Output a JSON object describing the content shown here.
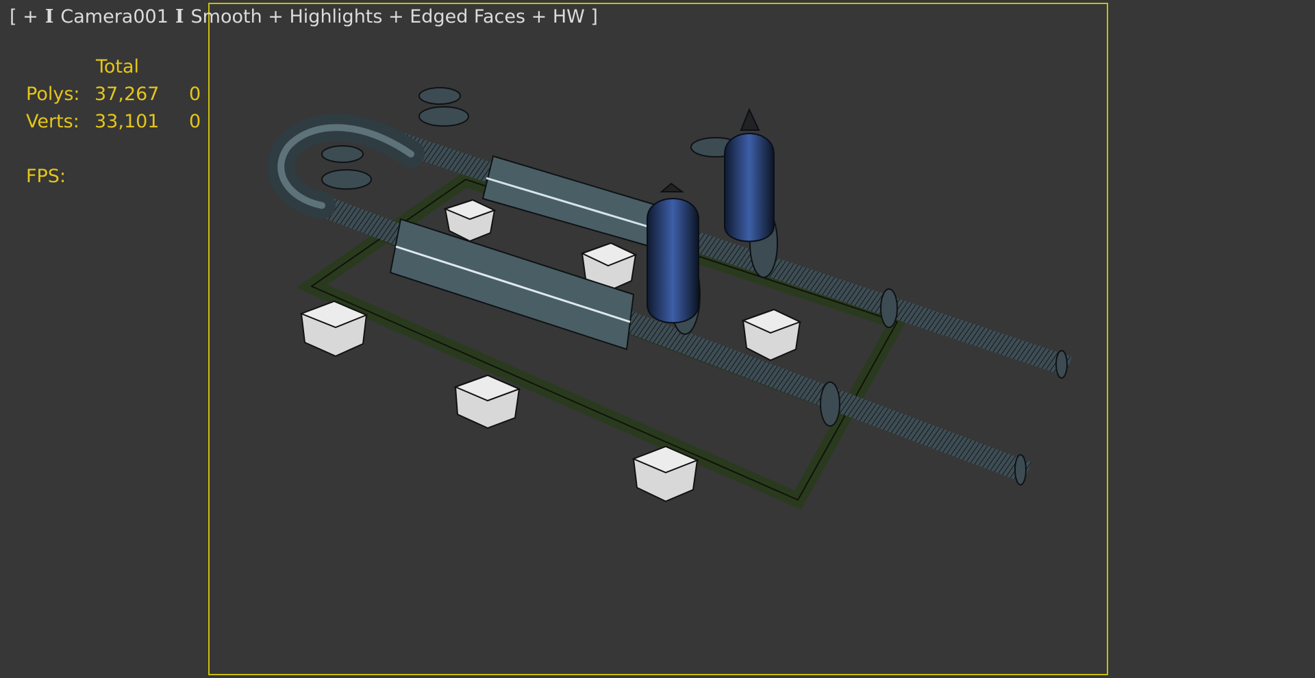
{
  "viewport": {
    "label": {
      "menu": "[ + ]",
      "camera": "Camera001",
      "shading": "Smooth + Highlights + Edged Faces + HW ]",
      "separator": "I"
    },
    "frame_color": "#c8c00a",
    "background": "#373737"
  },
  "stats": {
    "header": "Total",
    "polys_label": "Polys:",
    "polys_total": "37,267",
    "polys_selected": "0",
    "verts_label": "Verts:",
    "verts_total": "33,101",
    "verts_selected": "0",
    "fps_label": "FPS:",
    "text_color": "#e6c619"
  },
  "scene": {
    "object": "pipe-skid-model",
    "colors": {
      "pipe": "#4a5e66",
      "frame": "#2e3f22",
      "support": "#d8d8d8",
      "vessel": "#2f4d8e"
    }
  }
}
